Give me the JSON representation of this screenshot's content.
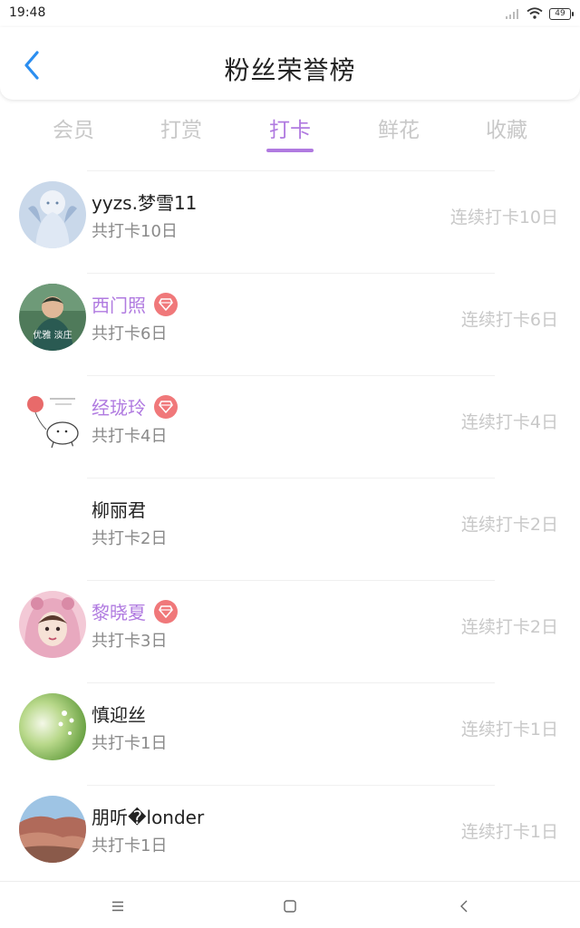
{
  "status_bar": {
    "time": "19:48",
    "battery": "49"
  },
  "header": {
    "title": "粉丝荣誉榜"
  },
  "tabs": [
    {
      "label": "会员"
    },
    {
      "label": "打赏"
    },
    {
      "label": "打卡"
    },
    {
      "label": "鲜花"
    },
    {
      "label": "收藏"
    }
  ],
  "active_tab": "打卡",
  "colors": {
    "accent": "#b07ae0",
    "badge": "#f0787a",
    "muted": "#c8c8c8",
    "secondary": "#8a8a8a"
  },
  "users": [
    {
      "name": "yyzs.梦雪11",
      "vip": false,
      "total": "共打卡10日",
      "streak": "连续打卡10日",
      "avatar": "anime-girl-avatar"
    },
    {
      "name": "西门照",
      "vip": true,
      "total": "共打卡6日",
      "streak": "连续打卡6日",
      "avatar": "person-green-avatar",
      "avatar_caption": "优雅 淡庄"
    },
    {
      "name": "经珑玲",
      "vip": true,
      "total": "共打卡4日",
      "streak": "连续打卡4日",
      "avatar": "balloon-sketch-avatar"
    },
    {
      "name": "柳丽君",
      "vip": false,
      "total": "共打卡2日",
      "streak": "连续打卡2日",
      "avatar": "blank-avatar"
    },
    {
      "name": "黎晓夏",
      "vip": true,
      "total": "共打卡3日",
      "streak": "连续打卡2日",
      "avatar": "pink-hood-girl-avatar"
    },
    {
      "name": "慎迎丝",
      "vip": false,
      "total": "共打卡1日",
      "streak": "连续打卡1日",
      "avatar": "green-flowers-avatar"
    },
    {
      "name": "朋听�londer",
      "vip": false,
      "total": "共打卡1日",
      "streak": "连续打卡1日",
      "avatar": "landscape-avatar"
    }
  ]
}
